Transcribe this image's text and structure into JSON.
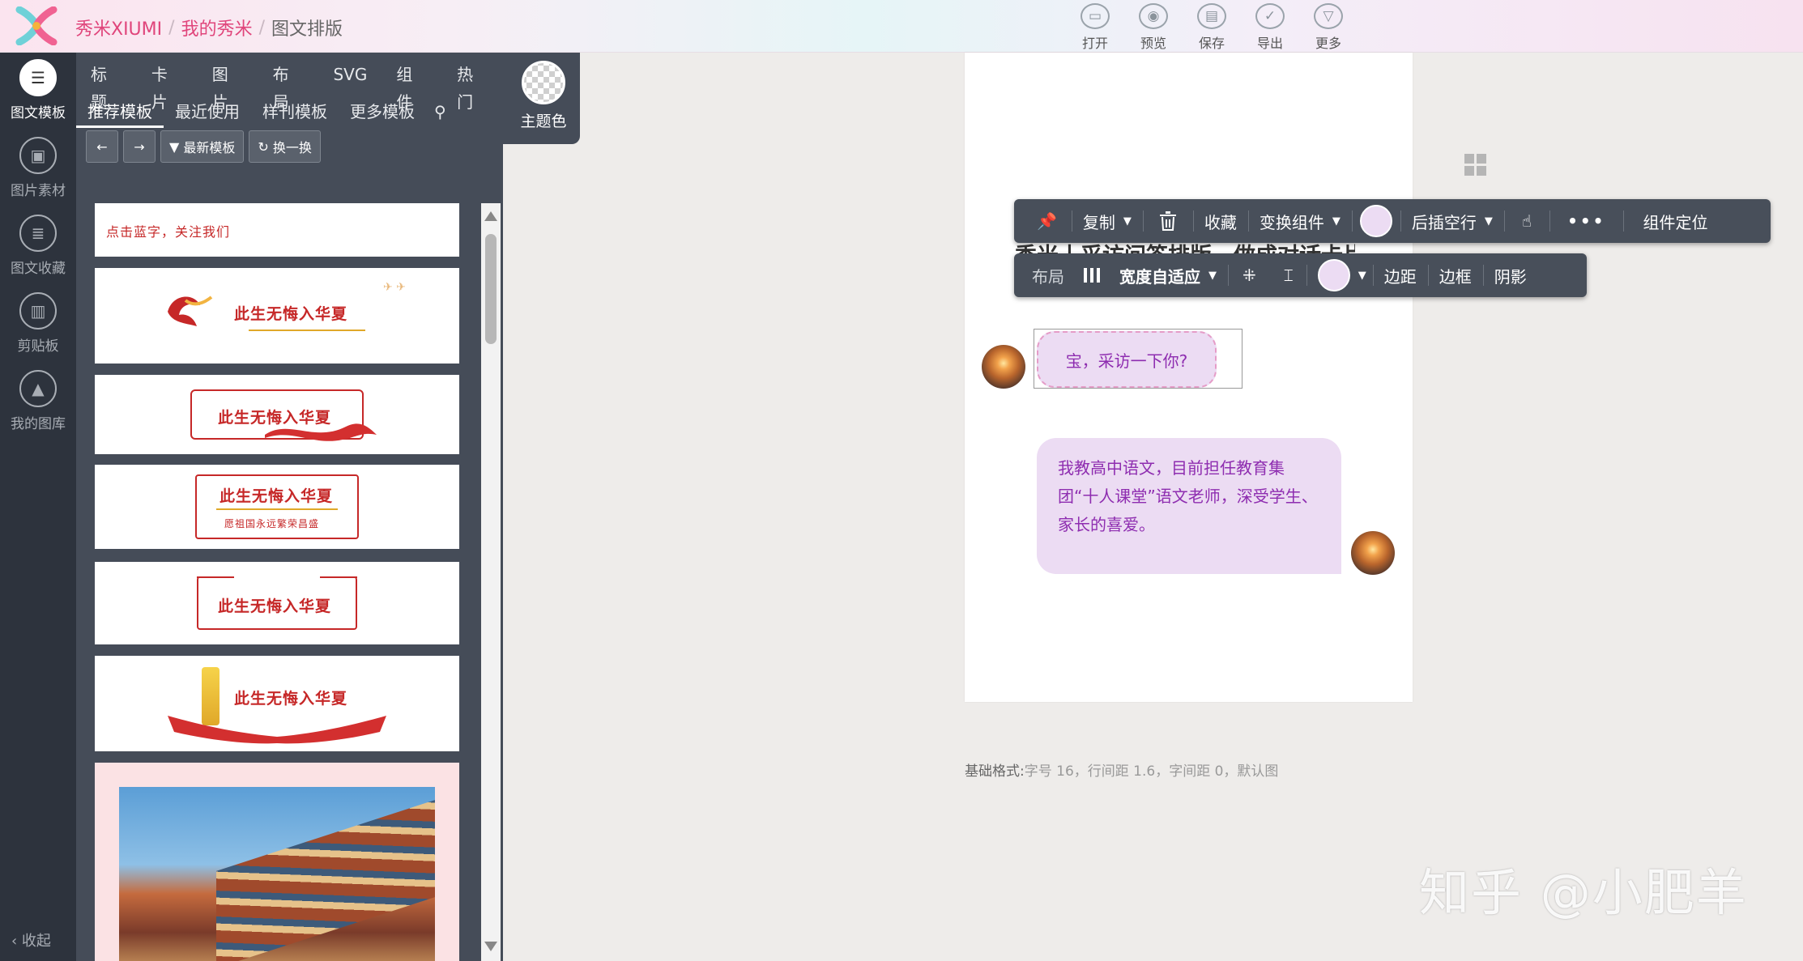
{
  "header": {
    "breadcrumbs": [
      "秀米XIUMI",
      "我的秀米",
      "图文排版"
    ],
    "actions": [
      {
        "label": "打开",
        "icon": "folder-icon"
      },
      {
        "label": "预览",
        "icon": "preview-icon"
      },
      {
        "label": "保存",
        "icon": "save-icon"
      },
      {
        "label": "导出",
        "icon": "export-icon"
      },
      {
        "label": "更多",
        "icon": "more-icon"
      }
    ]
  },
  "rail": {
    "items": [
      {
        "label": "图文模板",
        "icon": "template-icon"
      },
      {
        "label": "图片素材",
        "icon": "image-icon"
      },
      {
        "label": "图文收藏",
        "icon": "favorite-icon"
      },
      {
        "label": "剪贴板",
        "icon": "clipboard-icon"
      },
      {
        "label": "我的图库",
        "icon": "gallery-icon"
      }
    ],
    "collapse": "收起"
  },
  "panel": {
    "categories": [
      "标题",
      "卡片",
      "图片",
      "布局",
      "SVG",
      "组件",
      "热门"
    ],
    "subtabs": [
      "推荐模板",
      "最近使用",
      "样刊模板",
      "更多模板"
    ],
    "tools": {
      "newest": "最新模板",
      "shuffle": "换一换"
    },
    "theme_label": "主题色",
    "templates": [
      {
        "text": "点击蓝字，关注我们"
      },
      {
        "text": "此生无悔入华夏"
      },
      {
        "text": "此生无悔入华夏"
      },
      {
        "text": "此生无悔入华夏",
        "subtext": "愿祖国永远繁荣昌盛"
      },
      {
        "text": "此生无悔入华夏"
      },
      {
        "text": "此生无悔入华夏"
      }
    ]
  },
  "editor": {
    "hidden_title": "秀米丨采访问答排版，做成对话卡片",
    "bubble_question": "宝，采访一下你?",
    "bubble_answer": "我教高中语文，目前担任教育集团“十人课堂”语文老师，深受学生、家长的喜爱。",
    "base_format_label": "基础格式:",
    "base_format_value": "字号 16，行间距 1.6，字间距 0，默认图"
  },
  "toolbar1": {
    "copy": "复制",
    "collect": "收藏",
    "switch": "变换组件",
    "insert_after": "后插空行",
    "locate": "组件定位"
  },
  "toolbar2": {
    "layout": "布局",
    "width_fit": "宽度自适应",
    "margin": "边距",
    "border": "边框",
    "shadow": "阴影"
  },
  "watermark": "知乎 @小肥羊",
  "colors": {
    "brand": "#e0457b",
    "rail_bg": "#2d333d",
    "panel_bg": "#454c58",
    "bubble_bg": "#ecdcf3",
    "bubble_text": "#8e2db0",
    "template_red": "#c62828"
  }
}
